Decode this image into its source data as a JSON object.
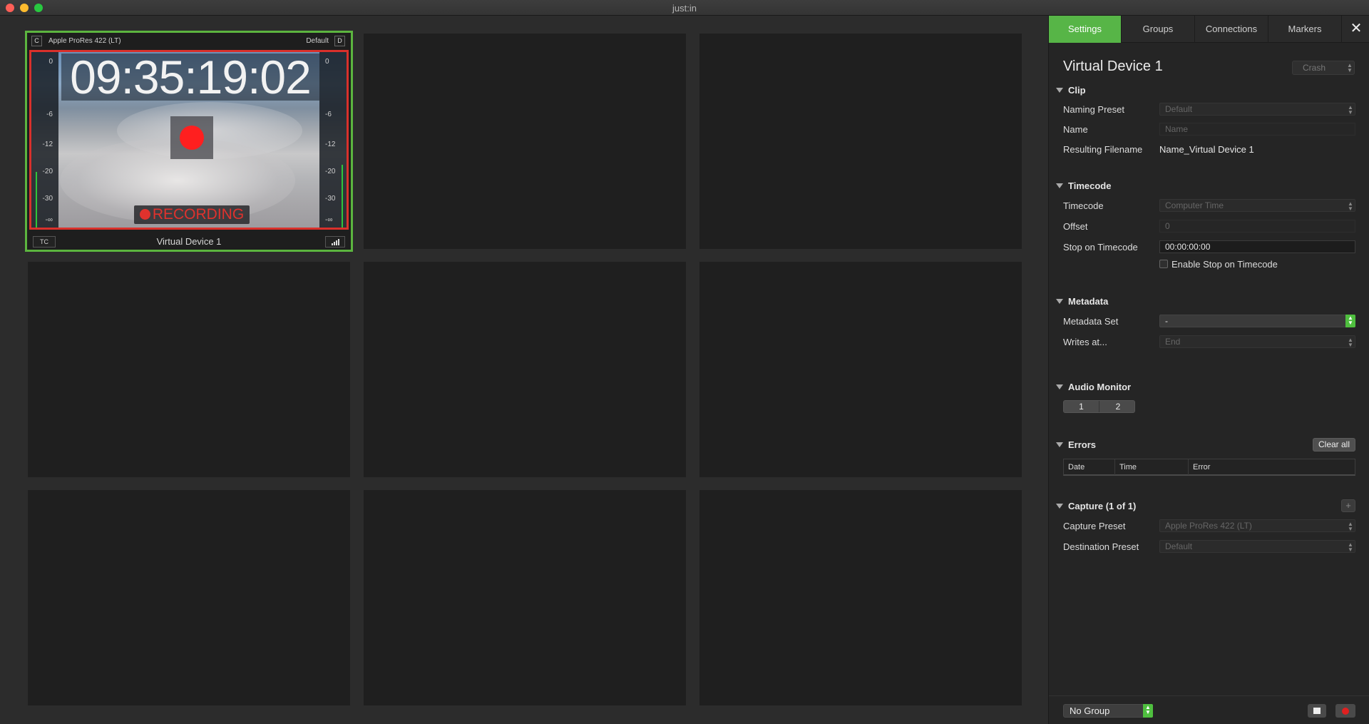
{
  "window": {
    "title": "just:in"
  },
  "tile": {
    "codec": "Apple ProRes 422 (LT)",
    "left_badge": "C",
    "destination": "Default",
    "right_badge": "D",
    "timecode": "09:35:19:02",
    "recording_label": "RECORDING",
    "meter_ticks": [
      "0",
      "-6",
      "-12",
      "-20",
      "-30",
      "-∞"
    ],
    "tc_button": "TC",
    "device_name": "Virtual Device 1"
  },
  "tabs": [
    "Settings",
    "Groups",
    "Connections",
    "Markers"
  ],
  "active_tab": "Settings",
  "panel": {
    "device_title": "Virtual Device 1",
    "crash_select": "Crash",
    "clip": {
      "section": "Clip",
      "naming_preset_label": "Naming Preset",
      "naming_preset_value": "Default",
      "name_label": "Name",
      "name_placeholder": "Name",
      "resulting_filename_label": "Resulting Filename",
      "resulting_filename_value": "Name_Virtual Device 1"
    },
    "timecode": {
      "section": "Timecode",
      "timecode_label": "Timecode",
      "timecode_value": "Computer Time",
      "offset_label": "Offset",
      "offset_value": "0",
      "stop_label": "Stop on Timecode",
      "stop_value": "00:00:00:00",
      "enable_stop_label": "Enable Stop on Timecode"
    },
    "metadata": {
      "section": "Metadata",
      "set_label": "Metadata Set",
      "set_value": "-",
      "writes_label": "Writes at...",
      "writes_value": "End"
    },
    "audio": {
      "section": "Audio Monitor",
      "channels": [
        "1",
        "2"
      ]
    },
    "errors": {
      "section": "Errors",
      "clear_button": "Clear all",
      "columns": [
        "Date",
        "Time",
        "Error"
      ]
    },
    "capture": {
      "section": "Capture (1 of 1)",
      "add_button": "+",
      "capture_preset_label": "Capture Preset",
      "capture_preset_value": "Apple ProRes 422 (LT)",
      "destination_preset_label": "Destination Preset",
      "destination_preset_value": "Default"
    },
    "footer": {
      "group_value": "No Group"
    }
  },
  "colors": {
    "accent_green": "#57b547",
    "record_red": "#ff1f1f",
    "border_red": "#d9302b"
  }
}
